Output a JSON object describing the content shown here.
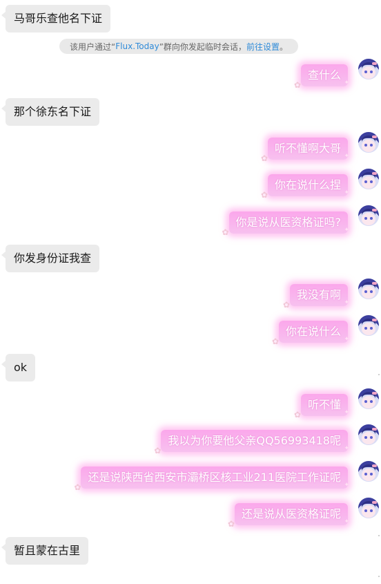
{
  "notice": {
    "prefix": "该用户通过“",
    "source": "Flux.Today",
    "middle": "”群向你发起临时会话，",
    "link": "前往设置",
    "suffix": "。"
  },
  "messages": [
    {
      "side": "in",
      "text": "马哥乐查他名下证"
    },
    {
      "side": "out",
      "text": "查什么"
    },
    {
      "side": "in",
      "text": "那个徐东名下证"
    },
    {
      "side": "out",
      "text": "听不懂啊大哥"
    },
    {
      "side": "out",
      "text": "你在说什么捏"
    },
    {
      "side": "out",
      "text": "你是说从医资格证吗?"
    },
    {
      "side": "in",
      "text": "你发身份证我查"
    },
    {
      "side": "out",
      "text": "我没有啊"
    },
    {
      "side": "out",
      "text": "你在说什么"
    },
    {
      "side": "in",
      "text": "ok"
    },
    {
      "side": "out",
      "text": "听不懂"
    },
    {
      "side": "out",
      "text": "我以为你要他父亲QQ56993418呢"
    },
    {
      "side": "out",
      "text": "还是说陕西省西安市灞桥区核工业211医院工作证呢"
    },
    {
      "side": "out",
      "text": "还是说从医资格证呢"
    },
    {
      "side": "in",
      "text": "暂且蒙在古里"
    }
  ],
  "colors": {
    "incoming_bubble": "#ebebeb",
    "outgoing_bubble": "#fba7eb",
    "link": "#2e8ad8"
  },
  "icons": {
    "avatar": "anime-avatar-icon",
    "bubble_decoration": "flower-icon"
  }
}
